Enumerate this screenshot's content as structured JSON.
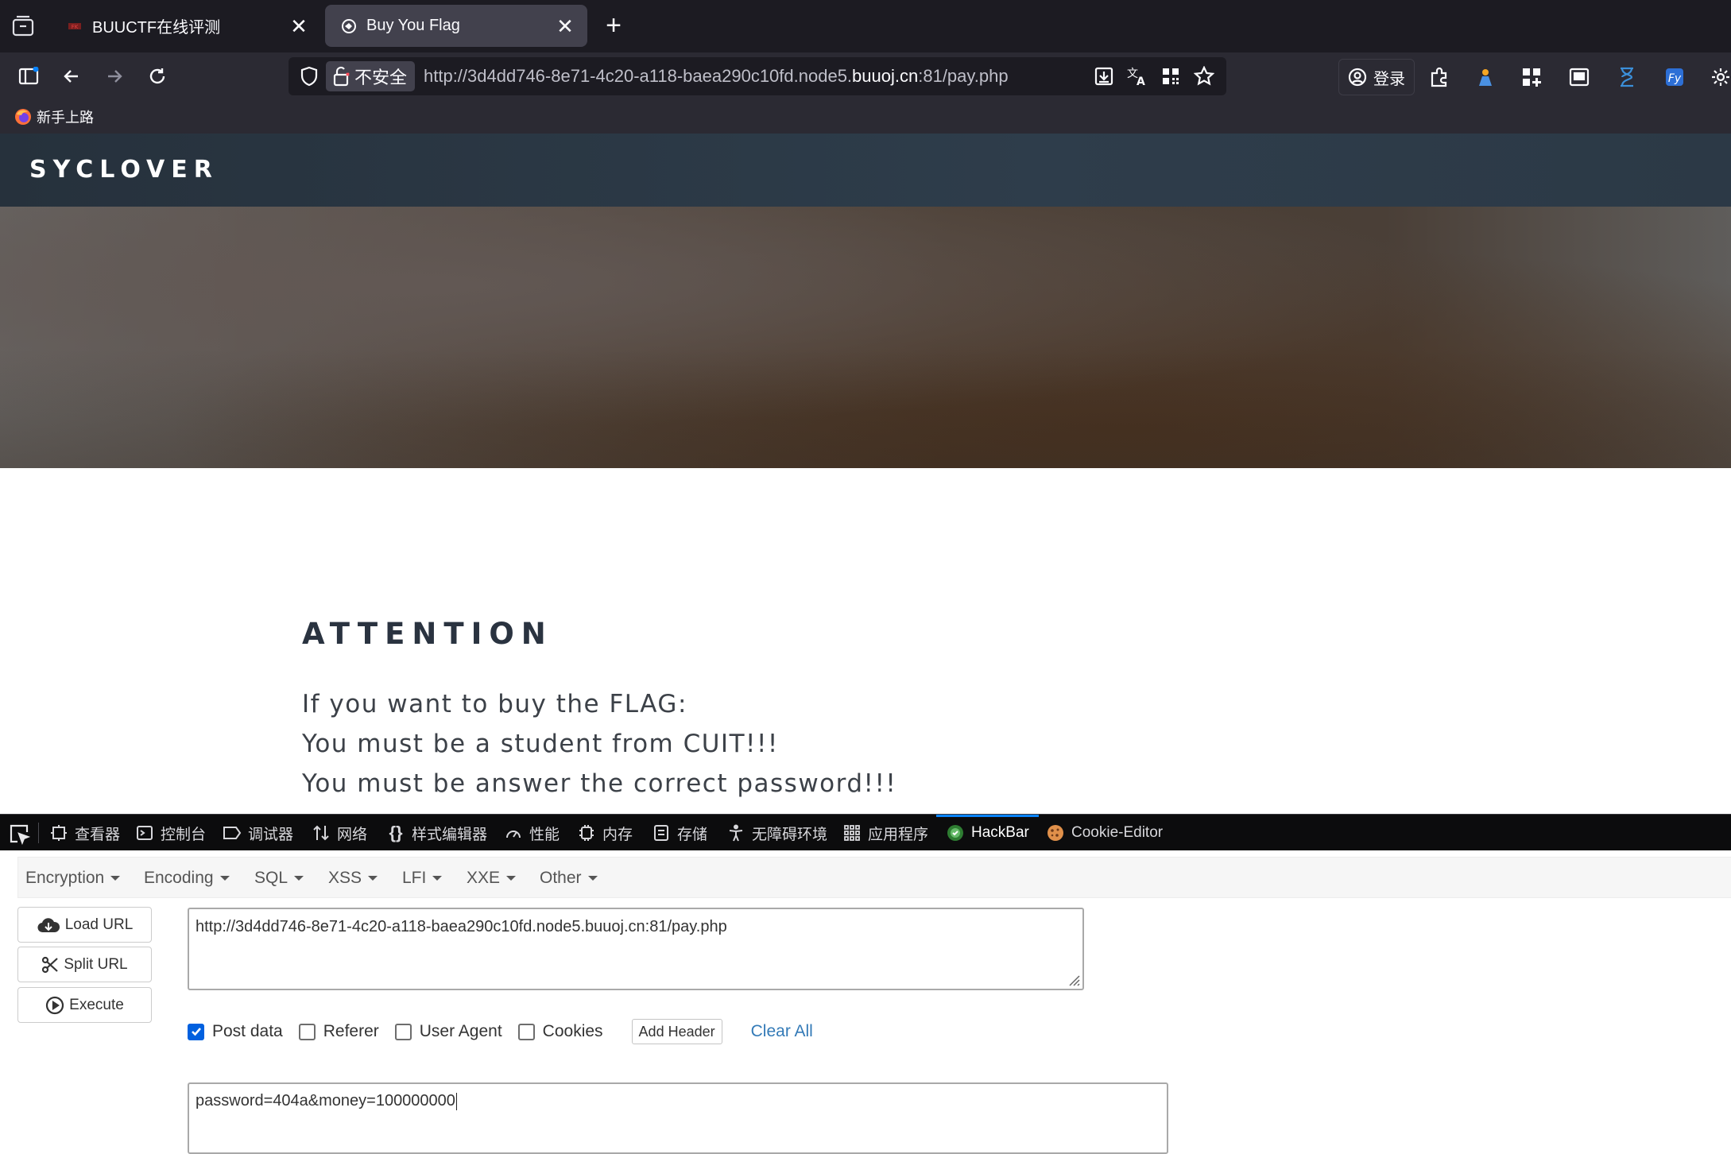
{
  "browser": {
    "tabs": [
      {
        "title": "BUUCTF在线评测",
        "close": "✕"
      },
      {
        "title": "Buy You Flag",
        "close": "✕"
      }
    ],
    "new_tab": "+",
    "security_label": "不安全",
    "url": {
      "prefix": "http://3d4dd746-8e71-4c20-a118-baea290c10fd.node5.",
      "host": "buuoj.cn",
      "suffix": ":81/pay.php"
    },
    "login_label": "登录",
    "bookmarks": [
      {
        "label": "新手上路"
      }
    ]
  },
  "page": {
    "site_name": "SYCLOVER",
    "heading": "ATTENTION",
    "messages": [
      "If you want to buy the FLAG:",
      "You must be a student from CUIT!!!",
      "You must be answer the correct password!!!"
    ]
  },
  "devtools": {
    "tabs": [
      {
        "label": "查看器",
        "icon": "inspector-icon"
      },
      {
        "label": "控制台",
        "icon": "console-icon"
      },
      {
        "label": "调试器",
        "icon": "debugger-icon"
      },
      {
        "label": "网络",
        "icon": "network-icon"
      },
      {
        "label": "样式编辑器",
        "icon": "style-editor-icon"
      },
      {
        "label": "性能",
        "icon": "performance-icon"
      },
      {
        "label": "内存",
        "icon": "memory-icon"
      },
      {
        "label": "存储",
        "icon": "storage-icon"
      },
      {
        "label": "无障碍环境",
        "icon": "accessibility-icon"
      },
      {
        "label": "应用程序",
        "icon": "application-icon"
      },
      {
        "label": "HackBar",
        "icon": "hackbar-icon"
      },
      {
        "label": "Cookie-Editor",
        "icon": "cookie-icon"
      }
    ],
    "selected_tab": "HackBar",
    "accent": "#0a84ff"
  },
  "hackbar": {
    "menu": [
      "Encryption",
      "Encoding",
      "SQL",
      "XSS",
      "LFI",
      "XXE",
      "Other"
    ],
    "buttons": {
      "load_url": "Load URL",
      "split_url": "Split URL",
      "execute": "Execute"
    },
    "url_value": "http://3d4dd746-8e71-4c20-a118-baea290c10fd.node5.buuoj.cn:81/pay.php",
    "options": {
      "post_data": {
        "label": "Post data",
        "checked": true
      },
      "referer": {
        "label": "Referer",
        "checked": false
      },
      "user_agent": {
        "label": "User Agent",
        "checked": false
      },
      "cookies": {
        "label": "Cookies",
        "checked": false
      }
    },
    "add_header": "Add Header",
    "clear_all": "Clear All",
    "post_value": "password=404a&money=100000000",
    "link_color": "#337ab7"
  }
}
